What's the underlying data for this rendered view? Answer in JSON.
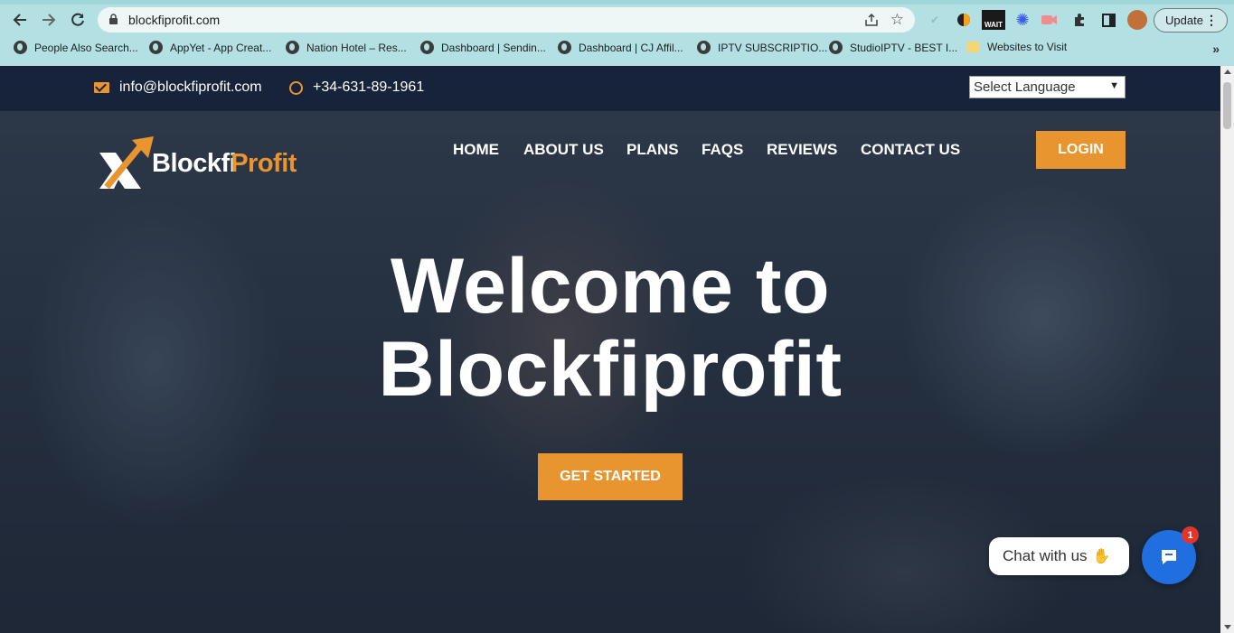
{
  "browser": {
    "url": "blockfiprofit.com",
    "update_label": "Update",
    "bookmarks": [
      {
        "label": "People Also Search..."
      },
      {
        "label": "AppYet - App Creat..."
      },
      {
        "label": "Nation Hotel – Res..."
      },
      {
        "label": "Dashboard | Sendin..."
      },
      {
        "label": "Dashboard | CJ Affil..."
      },
      {
        "label": "IPTV SUBSCRIPTIO..."
      },
      {
        "label": "StudioIPTV - BEST I..."
      },
      {
        "label": "Websites to Visit"
      }
    ],
    "extension_badge": "WAIT"
  },
  "topbar": {
    "email": "info@blockfiprofit.com",
    "phone": "+34-631-89-1961",
    "language_select": "Select Language"
  },
  "logo": {
    "part1": "Blockfi",
    "part2": "Profit"
  },
  "nav": {
    "items": [
      {
        "label": "HOME"
      },
      {
        "label": "ABOUT US"
      },
      {
        "label": "PLANS"
      },
      {
        "label": "FAQS"
      },
      {
        "label": "REVIEWS"
      },
      {
        "label": "CONTACT US"
      }
    ],
    "login": "LOGIN"
  },
  "hero": {
    "line1": "Welcome to",
    "line2": "Blockfiprofit",
    "cta": "GET STARTED"
  },
  "chat": {
    "label": "Chat with us",
    "badge": "1"
  },
  "colors": {
    "accent": "#e8952f",
    "topbar": "#16233a",
    "chat_blue": "#1f6fe0",
    "chrome": "#b3e0e3"
  }
}
